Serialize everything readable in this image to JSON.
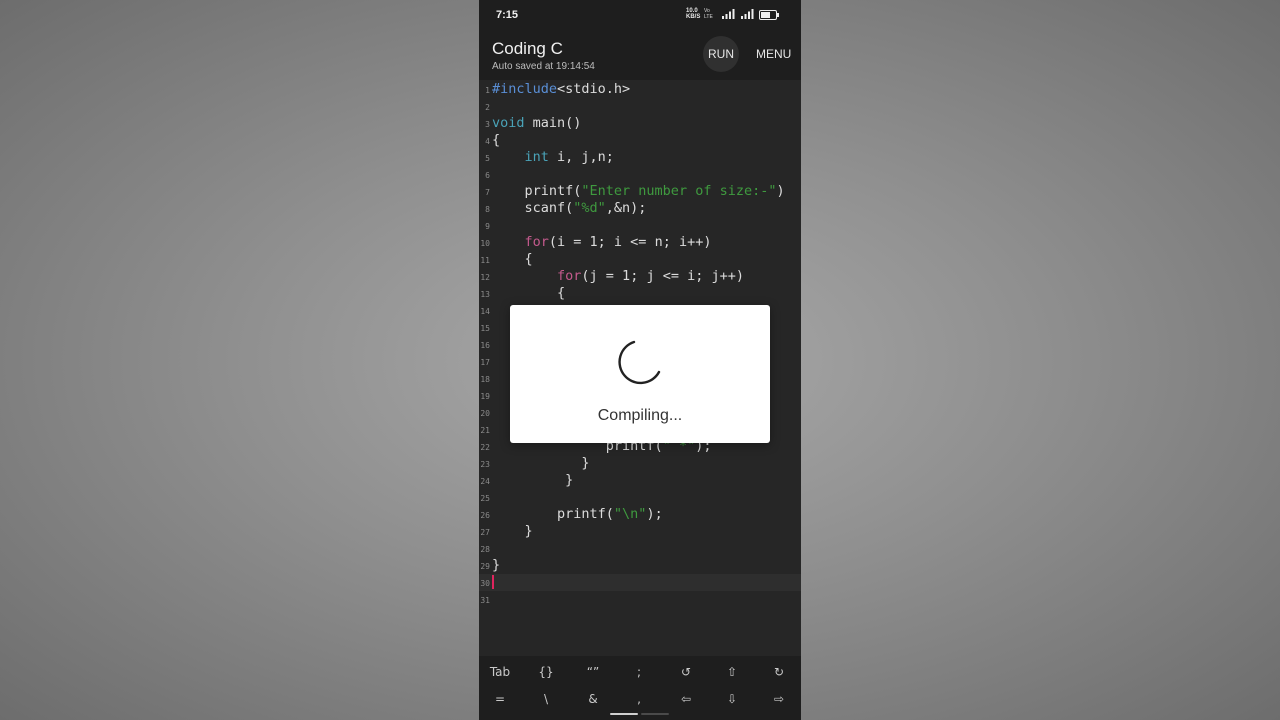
{
  "status_bar": {
    "time": "7:15",
    "net_speed": [
      "10.0",
      "KB/S"
    ],
    "volte": [
      "Vo",
      "LTE"
    ]
  },
  "app_bar": {
    "title": "Coding C",
    "subtitle": "Auto saved at 19:14:54",
    "run_label": "RUN",
    "menu_label": "MENU"
  },
  "editor": {
    "line_numbers": [
      "1",
      "2",
      "3",
      "4",
      "5",
      "6",
      "7",
      "8",
      "9",
      "10",
      "11",
      "12",
      "13",
      "14",
      "15",
      "16",
      "17",
      "18",
      "19",
      "20",
      "21",
      "22",
      "23",
      "24",
      "25",
      "26",
      "27",
      "28",
      "29",
      "30",
      "31"
    ],
    "lines": {
      "l1": [
        "#include",
        "<stdio.h>"
      ],
      "l3": [
        "void",
        " main()"
      ],
      "l4": "{",
      "l5": [
        "    ",
        "int",
        " i, j,n;"
      ],
      "l7": [
        "    printf(",
        "\"Enter number of size:-\"",
        ")"
      ],
      "l8": [
        "    scanf(",
        "\"%d\"",
        ",&n);"
      ],
      "l10": [
        "    ",
        "for",
        "(i = 1; i <= n; i++)"
      ],
      "l11": "    {",
      "l12": [
        "        ",
        "for",
        "(j = 1; j <= i; j++)"
      ],
      "l13": "        {",
      "l22": [
        "              printf(",
        "\" *\"",
        ");"
      ],
      "l23": "           }",
      "l24": "         }",
      "l26": [
        "        printf(",
        "\"\\n\"",
        ");"
      ],
      "l27": "    }",
      "l29": "}"
    },
    "current_line": "30"
  },
  "dialog": {
    "message": "Compiling..."
  },
  "keyboard_bar": {
    "row1": [
      "Tab",
      "{}",
      "“”",
      ";",
      "↺",
      "⇧",
      "↻"
    ],
    "row2": [
      "=",
      "\\",
      "&",
      ",",
      "⇦",
      "⇩",
      "⇨"
    ]
  },
  "colors": {
    "editor_bg": "#262626",
    "app_bar_bg": "#1e1e1e",
    "keyword_include": "#5a8fd6",
    "keyword_type": "#4aa3b8",
    "keyword_control": "#c45a8d",
    "string": "#3f9a3f",
    "cursor": "#e0245e"
  }
}
